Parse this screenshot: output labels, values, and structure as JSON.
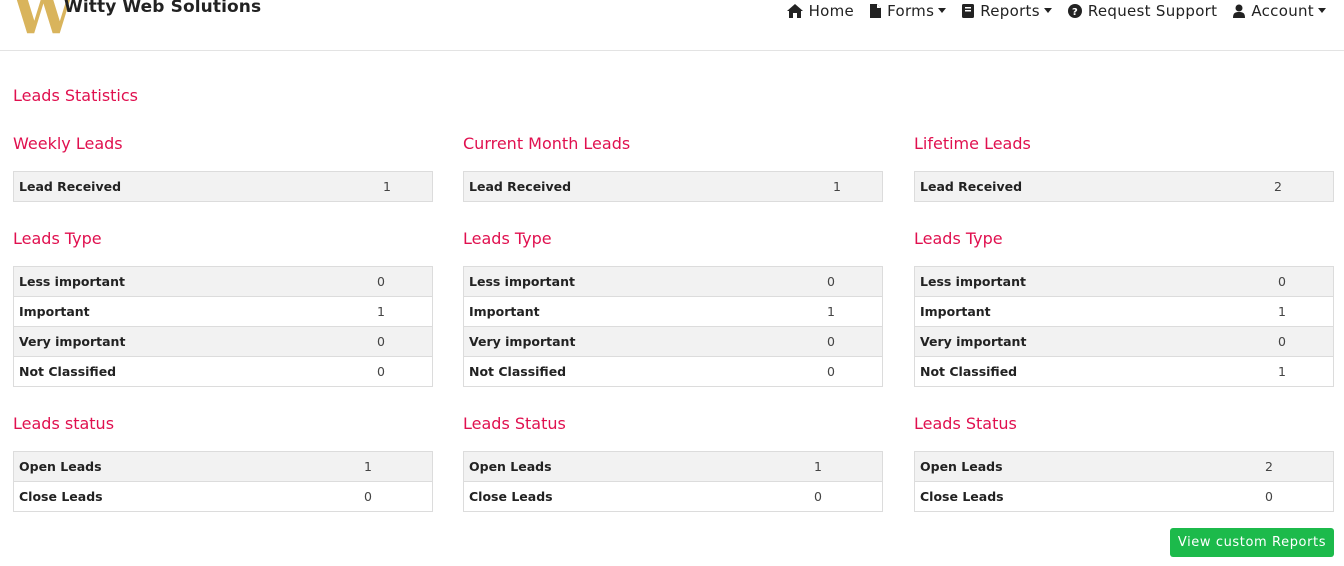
{
  "brand": {
    "logo_letter": "W",
    "name": "Witty Web Solutions"
  },
  "nav": {
    "home": "Home",
    "forms": "Forms",
    "reports": "Reports",
    "support": "Request Support",
    "account": "Account"
  },
  "page_title": "Leads Statistics",
  "columns": [
    {
      "total_title": "Weekly Leads",
      "total_rows": [
        {
          "label": "Lead Received",
          "value": "1"
        }
      ],
      "type_title": "Leads Type",
      "type_rows": [
        {
          "label": "Less important",
          "value": "0"
        },
        {
          "label": "Important",
          "value": "1"
        },
        {
          "label": "Very important",
          "value": "0"
        },
        {
          "label": "Not Classified",
          "value": "0"
        }
      ],
      "status_title": "Leads status",
      "status_rows": [
        {
          "label": "Open Leads",
          "value": "1"
        },
        {
          "label": "Close Leads",
          "value": "0"
        }
      ]
    },
    {
      "total_title": "Current Month Leads",
      "total_rows": [
        {
          "label": "Lead Received",
          "value": "1"
        }
      ],
      "type_title": "Leads Type",
      "type_rows": [
        {
          "label": "Less important",
          "value": "0"
        },
        {
          "label": "Important",
          "value": "1"
        },
        {
          "label": "Very important",
          "value": "0"
        },
        {
          "label": "Not Classified",
          "value": "0"
        }
      ],
      "status_title": "Leads Status",
      "status_rows": [
        {
          "label": "Open Leads",
          "value": "1"
        },
        {
          "label": "Close Leads",
          "value": "0"
        }
      ]
    },
    {
      "total_title": "Lifetime Leads",
      "total_rows": [
        {
          "label": "Lead Received",
          "value": "2"
        }
      ],
      "type_title": "Leads Type",
      "type_rows": [
        {
          "label": "Less important",
          "value": "0"
        },
        {
          "label": "Important",
          "value": "1"
        },
        {
          "label": "Very important",
          "value": "0"
        },
        {
          "label": "Not Classified",
          "value": "1"
        }
      ],
      "status_title": "Leads Status",
      "status_rows": [
        {
          "label": "Open Leads",
          "value": "2"
        },
        {
          "label": "Close Leads",
          "value": "0"
        }
      ]
    }
  ],
  "button": {
    "view_custom_reports": "View custom Reports"
  },
  "colors": {
    "heading": "#e0104f",
    "button": "#1cba4b",
    "logo": "#d9b45c",
    "row_shade": "#f2f2f2"
  },
  "icons": [
    "home-icon",
    "file-icon",
    "book-icon",
    "question-circle-icon",
    "user-icon"
  ]
}
